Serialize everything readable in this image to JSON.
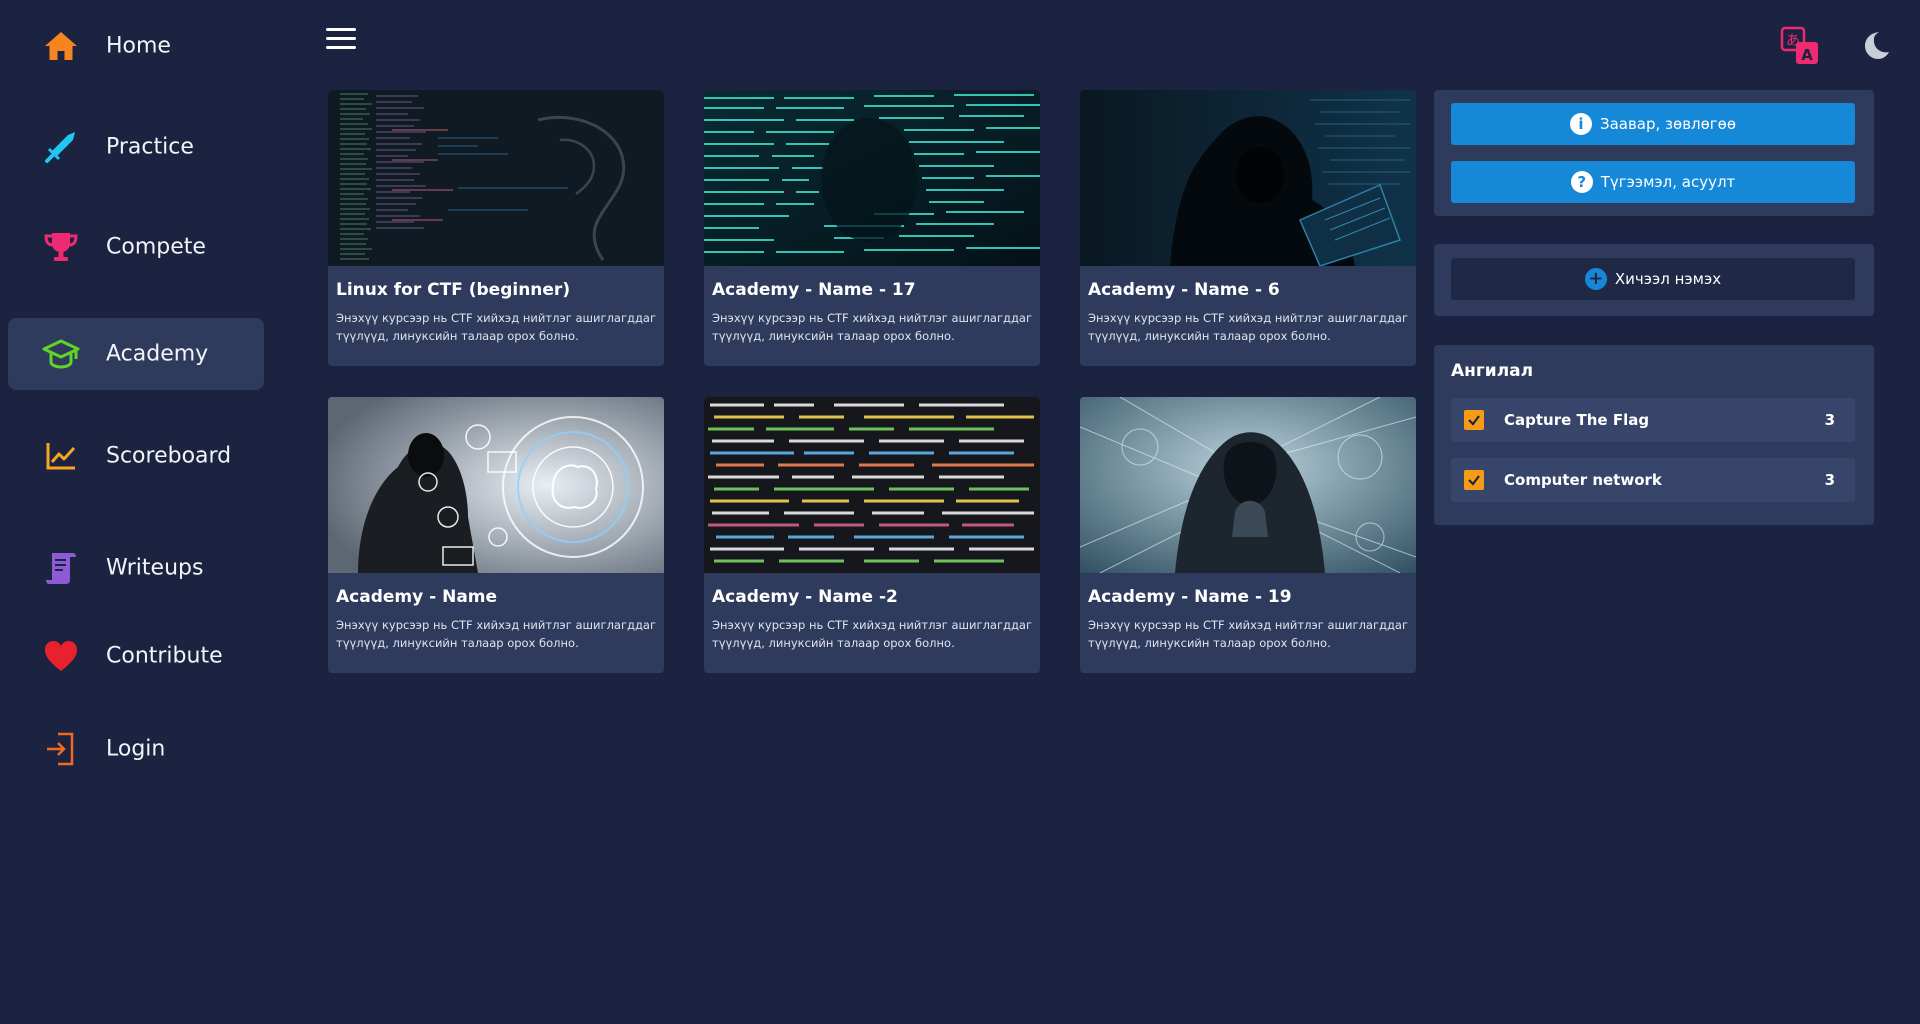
{
  "sidebar": {
    "items": [
      {
        "label": "Home",
        "icon": "home-icon",
        "color": "#f7851f"
      },
      {
        "label": "Practice",
        "icon": "sword-icon",
        "color": "#23c6f2"
      },
      {
        "label": "Compete",
        "icon": "trophy-icon",
        "color": "#ee2a72"
      },
      {
        "label": "Academy",
        "icon": "graduation-cap-icon",
        "color": "#5fd42a",
        "active": true
      },
      {
        "label": "Scoreboard",
        "icon": "chart-line-icon",
        "color": "#f5a623"
      },
      {
        "label": "Writeups",
        "icon": "scroll-icon",
        "color": "#8e5bd6"
      },
      {
        "label": "Contribute",
        "icon": "heart-icon",
        "color": "#e8222c"
      },
      {
        "label": "Login",
        "icon": "login-icon",
        "color": "#f26a21"
      }
    ]
  },
  "topbar": {
    "menu_icon": "hamburger-icon",
    "translate_icon": "translate-icon",
    "theme_icon": "moon-icon"
  },
  "courses": [
    {
      "title": "Linux for CTF (beginner)",
      "desc": "Энэхүү курсээр нь CTF хийхэд нийтлэг ашиглагддаг түүлүүд, линуксийн талаар орох болно."
    },
    {
      "title": "Academy - Name - 17",
      "desc": "Энэхүү курсээр нь CTF хийхэд нийтлэг ашиглагддаг түүлүүд, линуксийн талаар орох болно."
    },
    {
      "title": "Academy - Name - 6",
      "desc": "Энэхүү курсээр нь CTF хийхэд нийтлэг ашиглагддаг түүлүүд, линуксийн талаар орох болно."
    },
    {
      "title": "Academy - Name",
      "desc": "Энэхүү курсээр нь CTF хийхэд нийтлэг ашиглагддаг түүлүүд, линуксийн талаар орох болно."
    },
    {
      "title": "Academy - Name -2",
      "desc": "Энэхүү курсээр нь CTF хийхэд нийтлэг ашиглагддаг түүлүүд, линуксийн талаар орох болно."
    },
    {
      "title": "Academy - Name - 19",
      "desc": "Энэхүү курсээр нь CTF хийхэд нийтлэг ашиглагддаг түүлүүд, линуксийн талаар орох болно."
    }
  ],
  "panel": {
    "guide_label": "Заавар, зөвлөгөө",
    "faq_label": "Түгээмэл, асуулт",
    "add_lesson_label": "Хичээл нэмэх",
    "category_title": "Ангилал",
    "categories": [
      {
        "label": "Capture The Flag",
        "count": "3",
        "checked": true
      },
      {
        "label": "Computer network",
        "count": "3",
        "checked": true
      }
    ]
  },
  "colors": {
    "background": "#1c2340",
    "card": "#2f3b5d",
    "accent_blue": "#1589d8",
    "checkbox": "#f59b14"
  }
}
